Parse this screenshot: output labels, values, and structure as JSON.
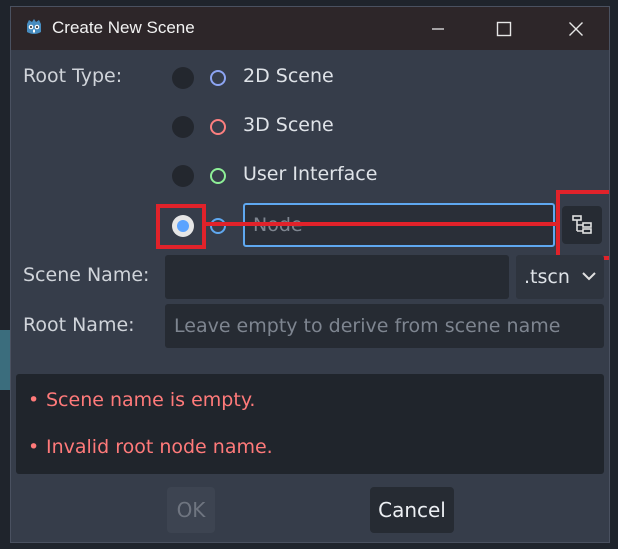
{
  "window": {
    "title": "Create New Scene",
    "app_icon": "godot-icon",
    "controls": [
      "minimize-icon",
      "maximize-icon",
      "close-icon"
    ]
  },
  "root_type": {
    "label": "Root Type:",
    "options": [
      {
        "label": "2D Scene",
        "ring_color": "#8da5f3",
        "selected": false
      },
      {
        "label": "3D Scene",
        "ring_color": "#fc7f7f",
        "selected": false
      },
      {
        "label": "User Interface",
        "ring_color": "#8eef97",
        "selected": false
      },
      {
        "label": "Node",
        "ring_color": "#5fa8f0",
        "selected": true
      }
    ],
    "node_picker_icon": "tree-hierarchy-icon"
  },
  "scene_name": {
    "label": "Scene Name:",
    "value": "",
    "extension": ".tscn"
  },
  "root_name": {
    "label": "Root Name:",
    "placeholder": "Leave empty to derive from scene name"
  },
  "messages": {
    "bullet": "•",
    "items": [
      "Scene name is empty.",
      "Invalid root node name."
    ]
  },
  "buttons": {
    "ok": "OK",
    "cancel": "Cancel"
  },
  "colors": {
    "accent": "#5fa8f0",
    "error": "#ff7a7a",
    "highlight": "#e1222a"
  }
}
